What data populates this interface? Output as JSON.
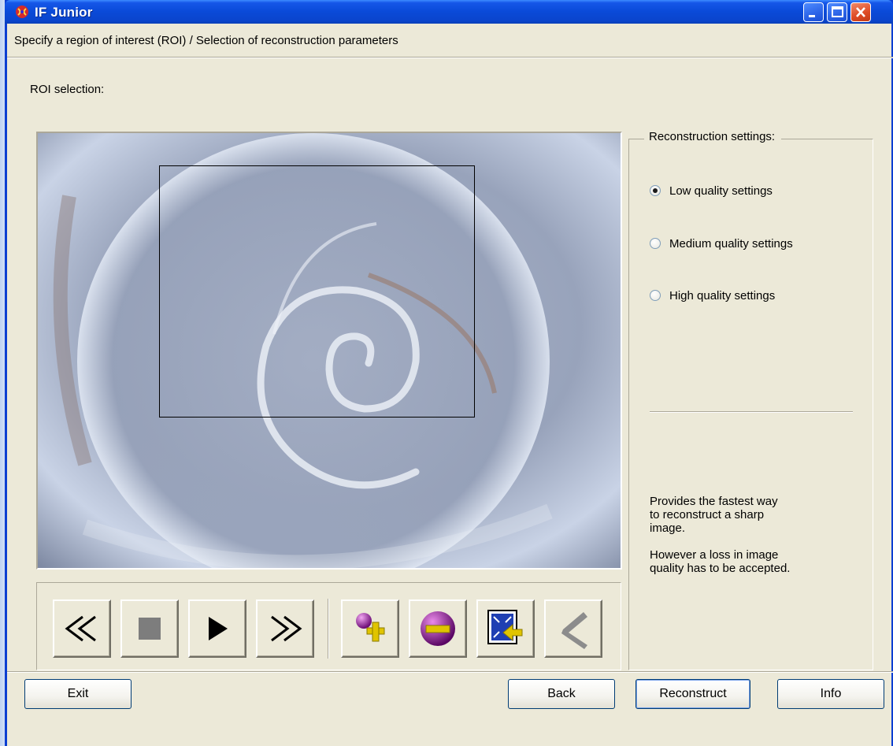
{
  "window": {
    "title": "IF Junior"
  },
  "header": {
    "subtitle": "Specify a region of interest (ROI) / Selection of reconstruction parameters"
  },
  "roi": {
    "label": "ROI selection:"
  },
  "toolbar": {
    "buttons": [
      {
        "name": "rewind",
        "icon": "double-chevron-left-icon"
      },
      {
        "name": "stop",
        "icon": "stop-square-icon"
      },
      {
        "name": "play",
        "icon": "play-triangle-icon"
      },
      {
        "name": "fast-forward",
        "icon": "double-chevron-right-icon"
      },
      {
        "name": "add-roi",
        "icon": "purple-ball-plus-icon"
      },
      {
        "name": "remove-roi",
        "icon": "purple-ball-minus-icon"
      },
      {
        "name": "fit-image",
        "icon": "image-arrow-icon"
      },
      {
        "name": "crop-tool",
        "icon": "crop-angle-icon"
      }
    ]
  },
  "settings": {
    "title": "Reconstruction settings:",
    "options": [
      {
        "label": "Low quality settings",
        "selected": true
      },
      {
        "label": "Medium quality settings",
        "selected": false
      },
      {
        "label": "High quality settings",
        "selected": false
      }
    ],
    "description_line1": "Provides the fastest way",
    "description_line2": "to reconstruct a sharp",
    "description_line3": "image.",
    "description_line4": "However a loss in image",
    "description_line5": "quality has to be accepted."
  },
  "footer": {
    "exit_label": "Exit",
    "back_label": "Back",
    "reconstruct_label": "Reconstruct",
    "info_label": "Info"
  },
  "colors": {
    "title_bar": "#0a4ad8",
    "dialog_bg": "#ece9d8",
    "close_button": "#dd4a24"
  }
}
